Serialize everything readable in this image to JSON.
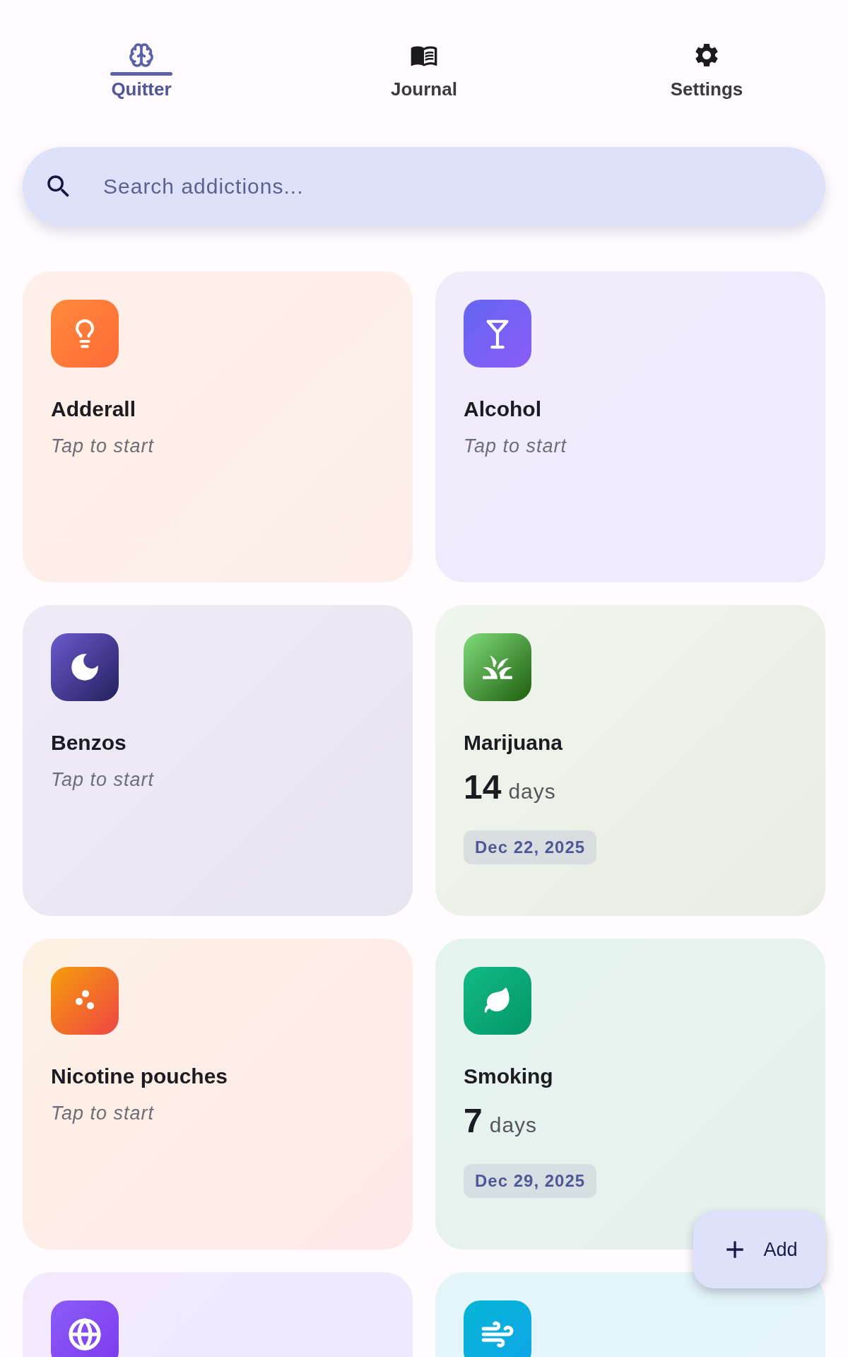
{
  "tabs": [
    {
      "label": "Quitter",
      "selected": true
    },
    {
      "label": "Journal",
      "selected": false
    },
    {
      "label": "Settings",
      "selected": false
    }
  ],
  "search": {
    "placeholder": "Search addictions..."
  },
  "cards": [
    {
      "kind": "idle",
      "name": "Adderall",
      "hint": "Tap to start"
    },
    {
      "kind": "idle",
      "name": "Alcohol",
      "hint": "Tap to start"
    },
    {
      "kind": "idle",
      "name": "Benzos",
      "hint": "Tap to start"
    },
    {
      "kind": "streak",
      "name": "Marijuana",
      "count": "14",
      "unit": "days",
      "date": "Dec 22, 2025"
    },
    {
      "kind": "idle",
      "name": "Nicotine pouches",
      "hint": "Tap to start"
    },
    {
      "kind": "streak",
      "name": "Smoking",
      "count": "7",
      "unit": "days",
      "date": "Dec 29, 2025"
    },
    {
      "kind": "cut"
    },
    {
      "kind": "cut"
    }
  ],
  "fab": {
    "label": "Add"
  }
}
